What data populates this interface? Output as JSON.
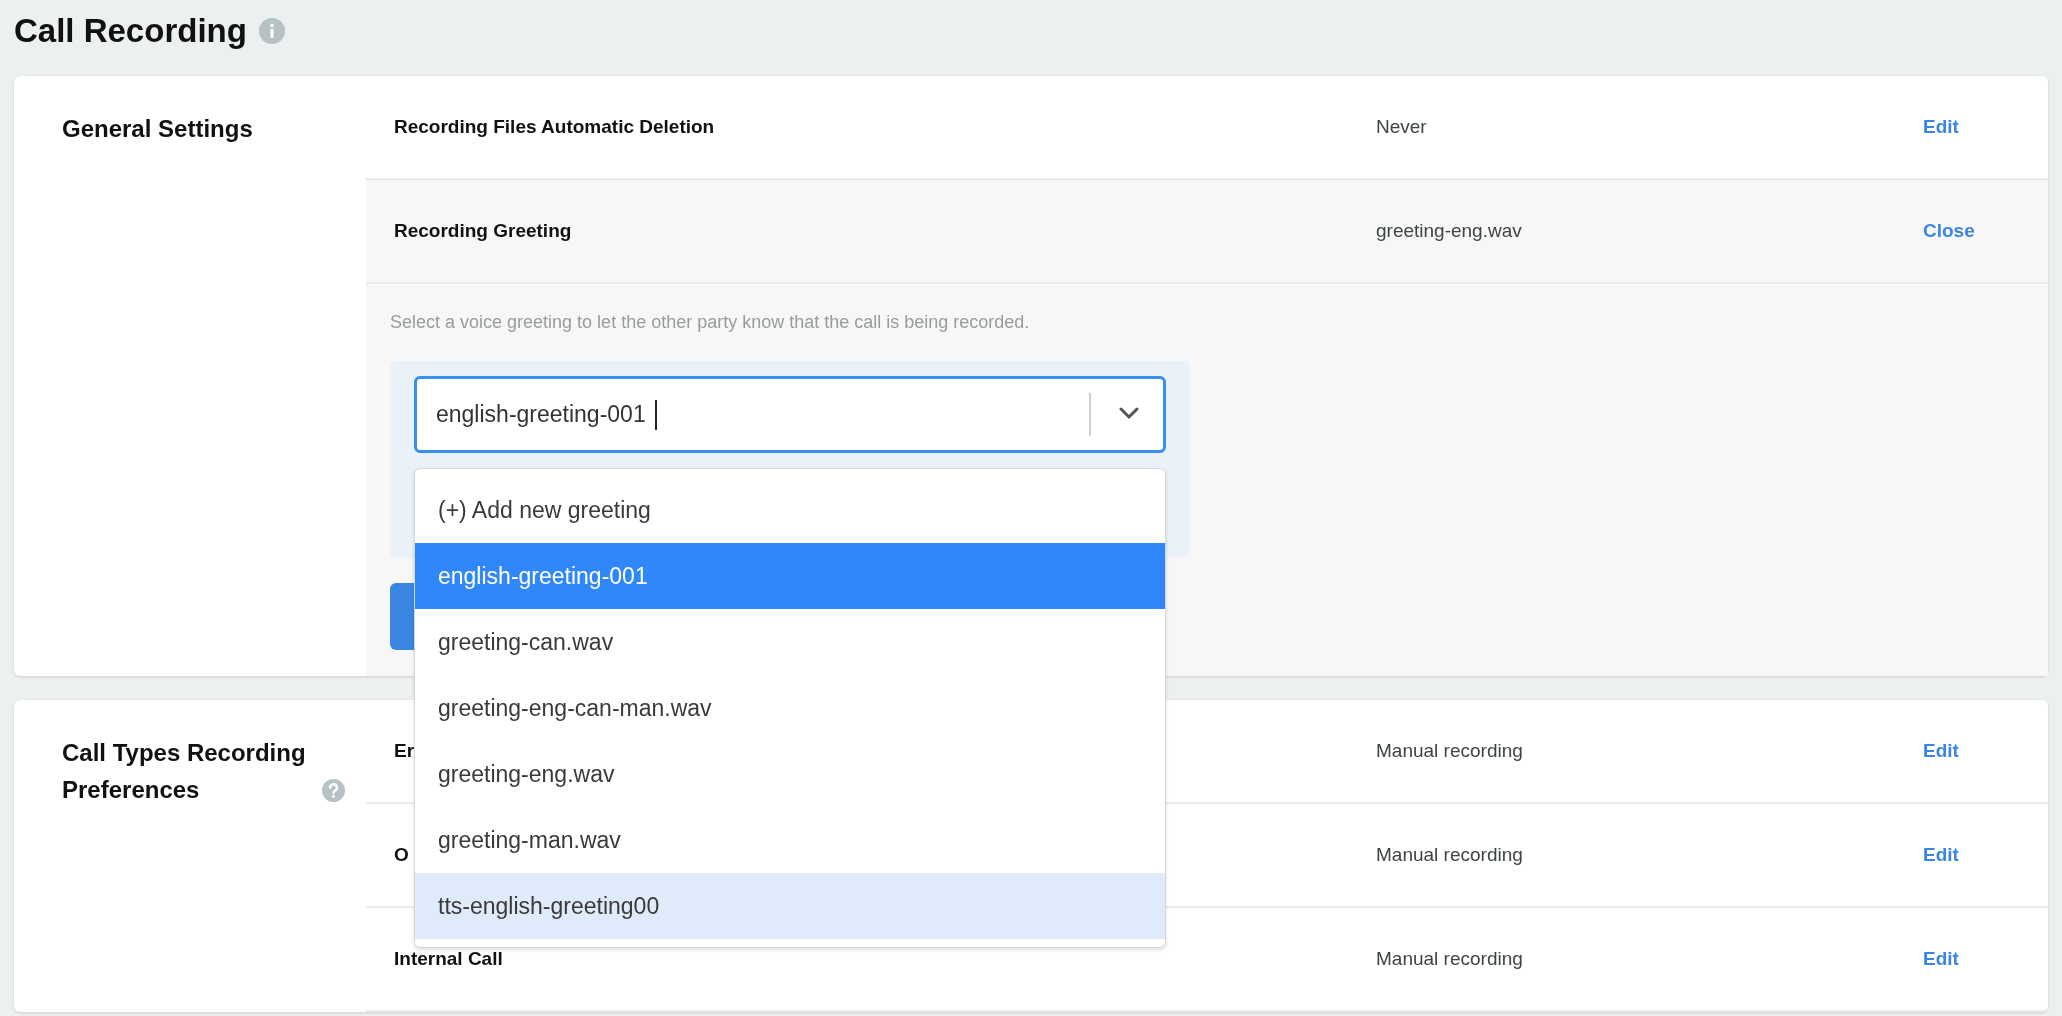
{
  "page": {
    "title": "Call Recording"
  },
  "general_settings": {
    "title": "General Settings",
    "rows": [
      {
        "label": "Recording Files Automatic Deletion",
        "value": "Never",
        "action": "Edit",
        "expanded": false
      },
      {
        "label": "Recording Greeting",
        "value": "greeting-eng.wav",
        "action": "Close",
        "expanded": true
      }
    ]
  },
  "greeting_editor": {
    "description": "Select a voice greeting to let the other party know that the call is being recorded.",
    "select": {
      "value": "english-greeting-001",
      "open": true
    },
    "options": [
      {
        "label": "(+) Add new greeting",
        "selected": false,
        "highlighted": false
      },
      {
        "label": "english-greeting-001",
        "selected": true,
        "highlighted": false
      },
      {
        "label": "greeting-can.wav",
        "selected": false,
        "highlighted": false
      },
      {
        "label": "greeting-eng-can-man.wav",
        "selected": false,
        "highlighted": false
      },
      {
        "label": "greeting-eng.wav",
        "selected": false,
        "highlighted": false
      },
      {
        "label": "greeting-man.wav",
        "selected": false,
        "highlighted": false
      },
      {
        "label": "tts-english-greeting00",
        "selected": false,
        "highlighted": true
      }
    ]
  },
  "call_types": {
    "title": "Call Types Recording Preferences",
    "rows": [
      {
        "label": "Er",
        "value": "Manual recording",
        "action": "Edit",
        "expanded": false
      },
      {
        "label": "O",
        "value": "Manual recording",
        "action": "Edit",
        "expanded": false
      },
      {
        "label": "Internal Call",
        "value": "Manual recording",
        "action": "Edit",
        "expanded": false
      }
    ]
  }
}
